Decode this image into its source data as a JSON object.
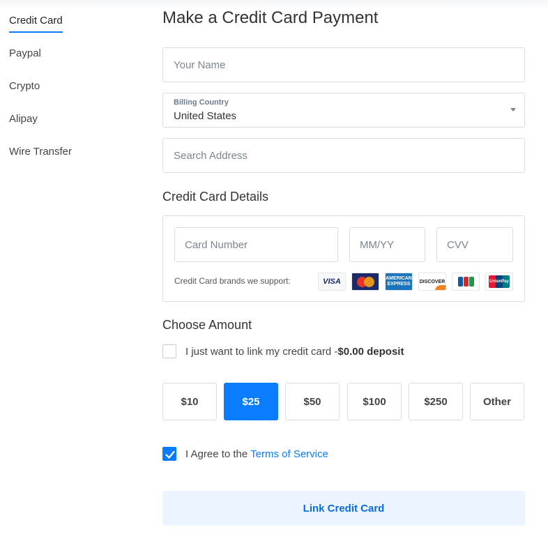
{
  "sidebar": {
    "items": [
      {
        "label": "Credit Card"
      },
      {
        "label": "Paypal"
      },
      {
        "label": "Crypto"
      },
      {
        "label": "Alipay"
      },
      {
        "label": "Wire Transfer"
      }
    ]
  },
  "main": {
    "title": "Make a Credit Card Payment",
    "name_placeholder": "Your Name",
    "country_label": "Billing Country",
    "country_value": "United States",
    "address_placeholder": "Search Address",
    "card_section_title": "Credit Card Details",
    "card_number_placeholder": "Card Number",
    "expiry_placeholder": "MM/YY",
    "cvv_placeholder": "CVV",
    "brands_label": "Credit Card brands we support:",
    "brands": {
      "visa": "VISA",
      "amex": "AMERICAN EXPRESS",
      "discover": "DISCOVER",
      "unionpay": "UnionPay"
    },
    "amount_section_title": "Choose Amount",
    "link_only_text": "I just want to link my credit card -",
    "link_only_bold": "$0.00 deposit",
    "link_only_checked": false,
    "amounts": [
      "$10",
      "$25",
      "$50",
      "$100",
      "$250",
      "Other"
    ],
    "selected_amount": "$25",
    "agree_text": "I Agree to the ",
    "terms_link": "Terms of Service",
    "agree_checked": true,
    "submit_label": "Link Credit Card"
  },
  "colors": {
    "accent": "#0a7cff",
    "submit_bg": "#ecf4ff",
    "border": "#d9dde3"
  }
}
